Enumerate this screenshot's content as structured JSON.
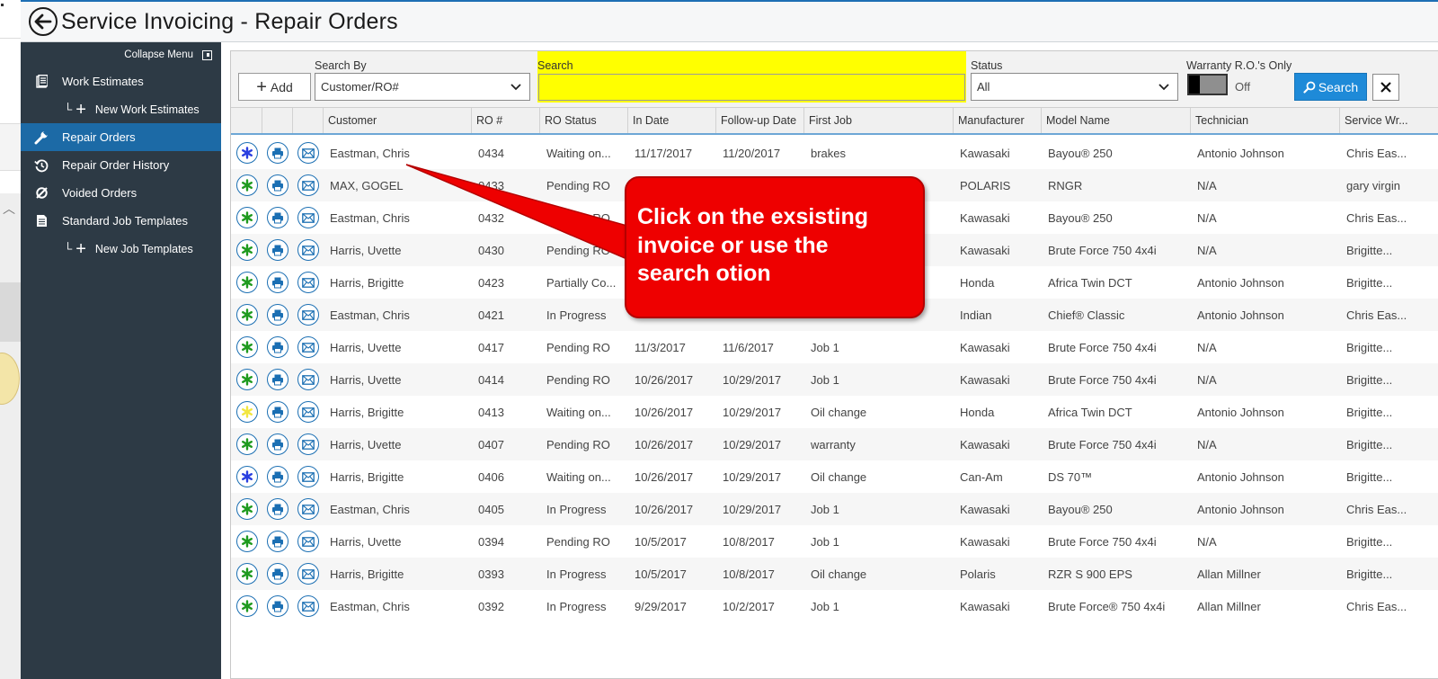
{
  "window": {
    "title": "Service Invoicing - Repair Orders"
  },
  "sidebar": {
    "collapse_label": "Collapse Menu",
    "items": [
      {
        "label": "Work Estimates",
        "icon": "document-icon"
      },
      {
        "label": "New Work Estimates",
        "icon": "plus-icon"
      },
      {
        "label": "Repair Orders",
        "icon": "wrench-icon",
        "active": true
      },
      {
        "label": "Repair Order History",
        "icon": "history-icon"
      },
      {
        "label": "Voided Orders",
        "icon": "void-icon"
      },
      {
        "label": "Standard Job Templates",
        "icon": "template-icon"
      },
      {
        "label": "New Job Templates",
        "icon": "plus-icon"
      }
    ]
  },
  "toolbar": {
    "add_label": "Add",
    "search_by_label": "Search By",
    "search_by_value": "Customer/RO#",
    "search_label": "Search",
    "search_value": "",
    "status_label": "Status",
    "status_value": "All",
    "warranty_label": "Warranty R.O.'s Only",
    "warranty_state": "Off",
    "search_button": "Search"
  },
  "table": {
    "columns": [
      "Customer",
      "RO #",
      "RO Status",
      "In Date",
      "Follow-up Date",
      "First Job",
      "Manufacturer",
      "Model Name",
      "Technician",
      "Service Wr..."
    ],
    "rows": [
      {
        "status_color": "blue",
        "customer": "Eastman, Chris",
        "ro": "0434",
        "status": "Waiting on...",
        "in_date": "11/17/2017",
        "followup": "11/20/2017",
        "job": "brakes",
        "mfr": "Kawasaki",
        "model": "Bayou® 250",
        "tech": "Antonio Johnson",
        "writer": "Chris Eas..."
      },
      {
        "status_color": "green",
        "customer": "MAX, GOGEL",
        "ro": "0433",
        "status": "Pending RO",
        "in_date": "",
        "followup": "",
        "job": "",
        "mfr": "POLARIS",
        "model": "RNGR",
        "tech": "N/A",
        "writer": "gary virgin"
      },
      {
        "status_color": "green",
        "customer": "Eastman, Chris",
        "ro": "0432",
        "status": "Pending RO",
        "in_date": "",
        "followup": "",
        "job": "",
        "mfr": "Kawasaki",
        "model": "Bayou® 250",
        "tech": "N/A",
        "writer": "Chris Eas..."
      },
      {
        "status_color": "green",
        "customer": "Harris, Uvette",
        "ro": "0430",
        "status": "Pending RO",
        "in_date": "",
        "followup": "",
        "job": "",
        "mfr": "Kawasaki",
        "model": "Brute Force 750 4x4i",
        "tech": "N/A",
        "writer": "Brigitte..."
      },
      {
        "status_color": "green",
        "customer": "Harris, Brigitte",
        "ro": "0423",
        "status": "Partially Co...",
        "in_date": "",
        "followup": "",
        "job": "",
        "mfr": "Honda",
        "model": "Africa Twin DCT",
        "tech": "Antonio Johnson",
        "writer": "Brigitte..."
      },
      {
        "status_color": "green",
        "customer": "Eastman, Chris",
        "ro": "0421",
        "status": "In Progress",
        "in_date": "",
        "followup": "",
        "job": "",
        "mfr": "Indian",
        "model": "Chief® Classic",
        "tech": "Antonio Johnson",
        "writer": "Chris Eas..."
      },
      {
        "status_color": "green",
        "customer": "Harris, Uvette",
        "ro": "0417",
        "status": "Pending RO",
        "in_date": "11/3/2017",
        "followup": "11/6/2017",
        "job": "Job 1",
        "mfr": "Kawasaki",
        "model": "Brute Force 750 4x4i",
        "tech": "N/A",
        "writer": "Brigitte..."
      },
      {
        "status_color": "green",
        "customer": "Harris, Uvette",
        "ro": "0414",
        "status": "Pending RO",
        "in_date": "10/26/2017",
        "followup": "10/29/2017",
        "job": "Job 1",
        "mfr": "Kawasaki",
        "model": "Brute Force 750 4x4i",
        "tech": "N/A",
        "writer": "Brigitte..."
      },
      {
        "status_color": "yellow",
        "customer": "Harris, Brigitte",
        "ro": "0413",
        "status": "Waiting on...",
        "in_date": "10/26/2017",
        "followup": "10/29/2017",
        "job": "Oil change",
        "mfr": "Honda",
        "model": "Africa Twin DCT",
        "tech": "Antonio Johnson",
        "writer": "Brigitte..."
      },
      {
        "status_color": "green",
        "customer": "Harris, Uvette",
        "ro": "0407",
        "status": "Pending RO",
        "in_date": "10/26/2017",
        "followup": "10/29/2017",
        "job": "warranty",
        "mfr": "Kawasaki",
        "model": "Brute Force 750 4x4i",
        "tech": "N/A",
        "writer": "Brigitte..."
      },
      {
        "status_color": "blue",
        "customer": "Harris, Brigitte",
        "ro": "0406",
        "status": "Waiting on...",
        "in_date": "10/26/2017",
        "followup": "10/29/2017",
        "job": "Oil change",
        "mfr": "Can-Am",
        "model": "DS 70™",
        "tech": "Antonio Johnson",
        "writer": "Brigitte..."
      },
      {
        "status_color": "green",
        "customer": "Eastman, Chris",
        "ro": "0405",
        "status": "In Progress",
        "in_date": "10/26/2017",
        "followup": "10/29/2017",
        "job": "Job 1",
        "mfr": "Kawasaki",
        "model": "Bayou® 250",
        "tech": "Antonio Johnson",
        "writer": "Chris Eas..."
      },
      {
        "status_color": "green",
        "customer": "Harris, Uvette",
        "ro": "0394",
        "status": "Pending RO",
        "in_date": "10/5/2017",
        "followup": "10/8/2017",
        "job": "Job 1",
        "mfr": "Kawasaki",
        "model": "Brute Force 750 4x4i",
        "tech": "N/A",
        "writer": "Brigitte..."
      },
      {
        "status_color": "green",
        "customer": "Harris, Brigitte",
        "ro": "0393",
        "status": "In Progress",
        "in_date": "10/5/2017",
        "followup": "10/8/2017",
        "job": "Oil change",
        "mfr": "Polaris",
        "model": "RZR S 900 EPS",
        "tech": "Allan Millner",
        "writer": "Brigitte..."
      },
      {
        "status_color": "green",
        "customer": "Eastman, Chris",
        "ro": "0392",
        "status": "In Progress",
        "in_date": "9/29/2017",
        "followup": "10/2/2017",
        "job": "Job 1",
        "mfr": "Kawasaki",
        "model": "Brute Force® 750 4x4i",
        "tech": "Allan Millner",
        "writer": "Chris Eas..."
      }
    ]
  },
  "callout": {
    "lines": [
      "Click on the exsisting",
      "invoice or use the",
      "search otion"
    ]
  },
  "colors": {
    "sidebar_bg": "#2d3a45",
    "active_nav": "#1c6aa6",
    "search_highlight": "#ffff00",
    "search_button": "#1e8ad8",
    "callout": "#ee0000",
    "status_green": "#1f9a1f",
    "status_blue": "#2a3fe0",
    "status_yellow": "#f2e640"
  }
}
